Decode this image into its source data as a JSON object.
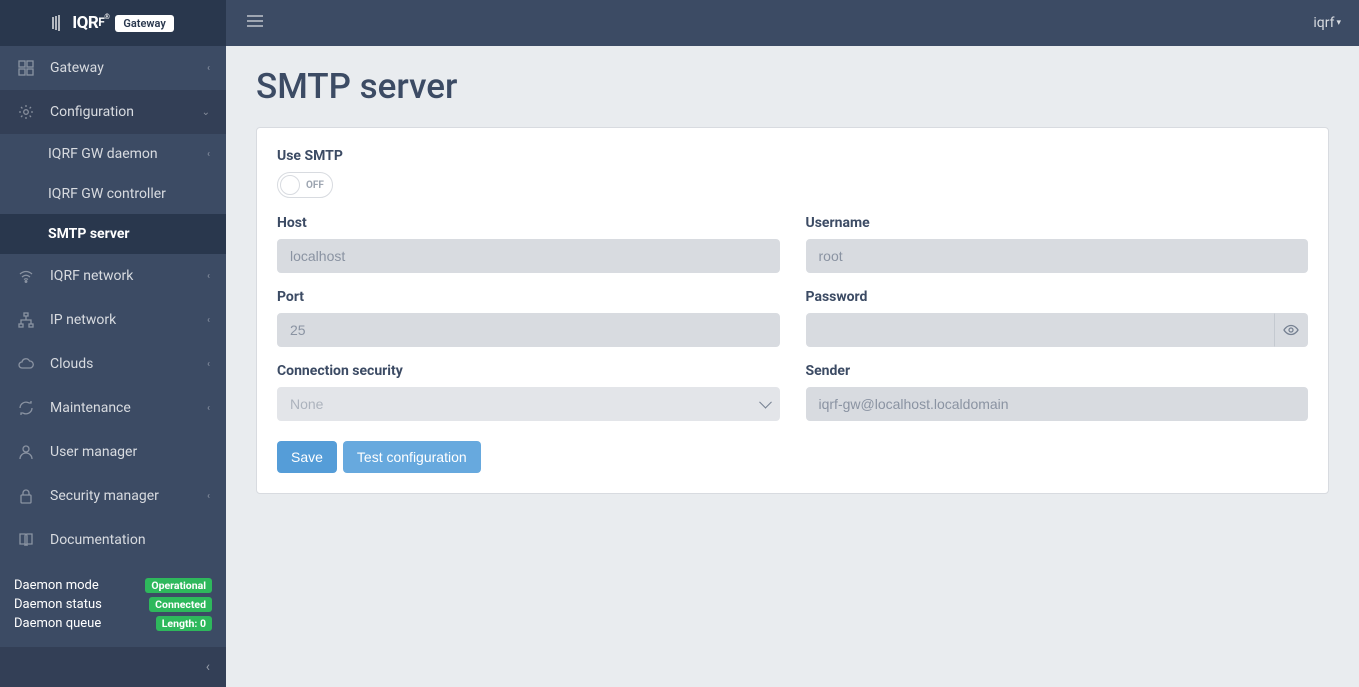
{
  "brand": {
    "badge": "Gateway"
  },
  "topbar": {
    "user": "iqrf"
  },
  "sidebar": {
    "items": [
      {
        "label": "Gateway"
      },
      {
        "label": "Configuration"
      },
      {
        "label": "IQRF GW daemon"
      },
      {
        "label": "IQRF GW controller"
      },
      {
        "label": "SMTP server"
      },
      {
        "label": "IQRF network"
      },
      {
        "label": "IP network"
      },
      {
        "label": "Clouds"
      },
      {
        "label": "Maintenance"
      },
      {
        "label": "User manager"
      },
      {
        "label": "Security manager"
      },
      {
        "label": "Documentation"
      }
    ]
  },
  "status": {
    "rows": [
      {
        "label": "Daemon mode",
        "badge": "Operational"
      },
      {
        "label": "Daemon status",
        "badge": "Connected"
      },
      {
        "label": "Daemon queue",
        "badge": "Length: 0"
      }
    ]
  },
  "page": {
    "title": "SMTP server"
  },
  "form": {
    "use_smtp_label": "Use SMTP",
    "toggle_text": "OFF",
    "host_label": "Host",
    "host_value": "localhost",
    "port_label": "Port",
    "port_value": "25",
    "connsec_label": "Connection security",
    "connsec_value": "None",
    "username_label": "Username",
    "username_value": "root",
    "password_label": "Password",
    "password_value": "",
    "sender_label": "Sender",
    "sender_value": "iqrf-gw@localhost.localdomain",
    "save_label": "Save",
    "test_label": "Test configuration"
  }
}
